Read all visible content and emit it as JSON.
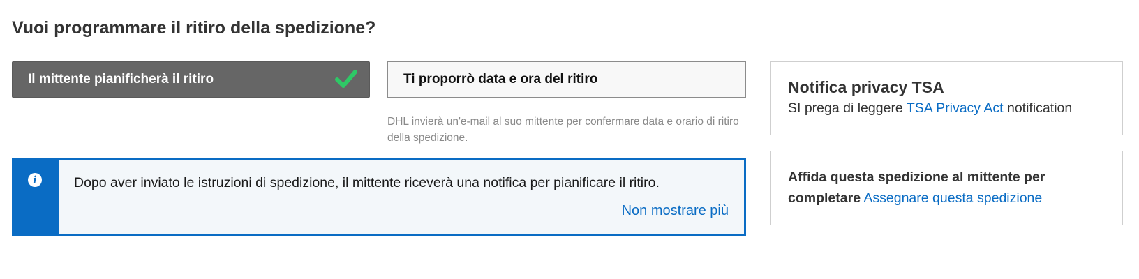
{
  "page_title": "Vuoi programmare il ritiro della spedizione?",
  "options": {
    "selected_label": "Il mittente pianificherà il ritiro",
    "alternative_label": "Ti proporrò data e ora del ritiro",
    "alternative_hint": "DHL invierà un'e-mail al suo mittente per confermare data e orario di ritiro della spedizione."
  },
  "info_banner": {
    "icon": "info-icon",
    "icon_glyph": "i",
    "message": "Dopo aver inviato le istruzioni di spedizione, il mittente riceverà una notifica per pianificare il ritiro.",
    "dismiss_link": "Non mostrare più"
  },
  "privacy_card": {
    "title": "Notifica privacy TSA",
    "text_before": "SI prega di leggere ",
    "link": "TSA Privacy Act",
    "text_after": " notification"
  },
  "assign_card": {
    "text": "Affida questa spedizione al mittente per completare",
    "link": "Assegnare questa spedizione"
  },
  "colors": {
    "accent": "#0a6cc4",
    "selected_bg": "#666666",
    "check": "#2ec866",
    "banner_bg": "#f3f7fa"
  }
}
